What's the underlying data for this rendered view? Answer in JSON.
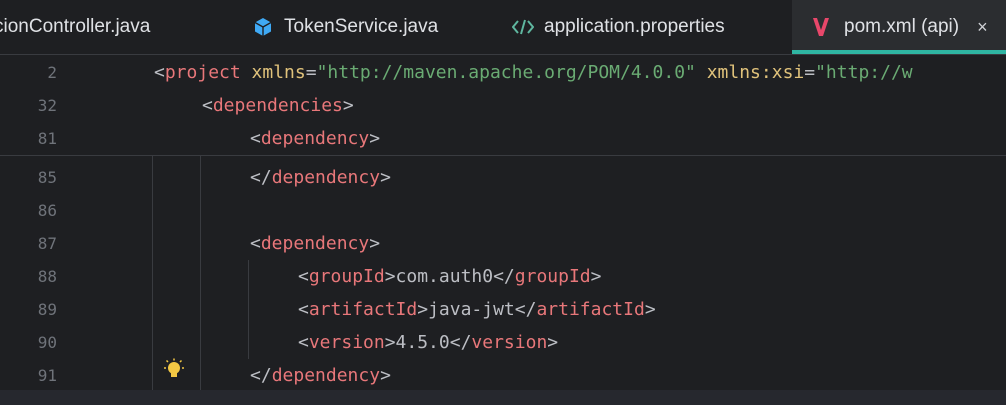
{
  "tabs": [
    {
      "label": "cionController.java",
      "icon": "java-class-icon",
      "active": false
    },
    {
      "label": "TokenService.java",
      "icon": "cube-icon",
      "active": false
    },
    {
      "label": "application.properties",
      "icon": "properties-code-icon",
      "active": false
    },
    {
      "label": "pom.xml (api)",
      "icon": "maven-v-icon",
      "active": true,
      "close": "×"
    }
  ],
  "sticky_lines": [
    {
      "n": "2",
      "indent": 0,
      "parts": [
        {
          "t": "<",
          "c": "brk"
        },
        {
          "t": "project ",
          "c": "xtag"
        },
        {
          "t": "xmlns",
          "c": "attrn"
        },
        {
          "t": "=",
          "c": "brk"
        },
        {
          "t": "\"http://maven.apache.org/POM/4.0.0\"",
          "c": "str"
        },
        {
          "t": " xmlns:xsi",
          "c": "attrn"
        },
        {
          "t": "=",
          "c": "brk"
        },
        {
          "t": "\"http://w",
          "c": "str"
        }
      ]
    },
    {
      "n": "32",
      "indent": 1,
      "parts": [
        {
          "t": "<",
          "c": "brk"
        },
        {
          "t": "dependencies",
          "c": "xtag"
        },
        {
          "t": ">",
          "c": "brk"
        }
      ]
    },
    {
      "n": "81",
      "indent": 2,
      "parts": [
        {
          "t": "<",
          "c": "brk"
        },
        {
          "t": "dependency",
          "c": "xtag"
        },
        {
          "t": ">",
          "c": "brk"
        }
      ]
    }
  ],
  "lines": [
    {
      "n": "85",
      "indent": 2,
      "parts": [
        {
          "t": "</",
          "c": "brk"
        },
        {
          "t": "dependency",
          "c": "xtag"
        },
        {
          "t": ">",
          "c": "brk"
        }
      ]
    },
    {
      "n": "86",
      "indent": 0,
      "parts": []
    },
    {
      "n": "87",
      "indent": 2,
      "parts": [
        {
          "t": "<",
          "c": "brk"
        },
        {
          "t": "dependency",
          "c": "xtag"
        },
        {
          "t": ">",
          "c": "brk"
        }
      ]
    },
    {
      "n": "88",
      "indent": 3,
      "parts": [
        {
          "t": "<",
          "c": "brk"
        },
        {
          "t": "groupId",
          "c": "xtag"
        },
        {
          "t": ">",
          "c": "brk"
        },
        {
          "t": "com.auth0",
          "c": "text"
        },
        {
          "t": "</",
          "c": "brk"
        },
        {
          "t": "groupId",
          "c": "xtag"
        },
        {
          "t": ">",
          "c": "brk"
        }
      ]
    },
    {
      "n": "89",
      "indent": 3,
      "parts": [
        {
          "t": "<",
          "c": "brk"
        },
        {
          "t": "artifactId",
          "c": "xtag"
        },
        {
          "t": ">",
          "c": "brk"
        },
        {
          "t": "java-jwt",
          "c": "text"
        },
        {
          "t": "</",
          "c": "brk"
        },
        {
          "t": "artifactId",
          "c": "xtag"
        },
        {
          "t": ">",
          "c": "brk"
        }
      ]
    },
    {
      "n": "90",
      "indent": 3,
      "parts": [
        {
          "t": "<",
          "c": "brk"
        },
        {
          "t": "version",
          "c": "xtag"
        },
        {
          "t": ">",
          "c": "brk"
        },
        {
          "t": "4.5.0",
          "c": "text"
        },
        {
          "t": "</",
          "c": "brk"
        },
        {
          "t": "version",
          "c": "xtag"
        },
        {
          "t": ">",
          "c": "brk"
        }
      ]
    },
    {
      "n": "91",
      "indent": 2,
      "parts": [
        {
          "t": "</",
          "c": "brk"
        },
        {
          "t": "dependency",
          "c": "xtag"
        },
        {
          "t": ">",
          "c": "brk"
        }
      ]
    }
  ],
  "colors": {
    "accent": "#2fb5a2",
    "tag": "#e8777a",
    "string": "#6aab73",
    "attr": "#e0c27b",
    "bulb": "#f2c744"
  }
}
